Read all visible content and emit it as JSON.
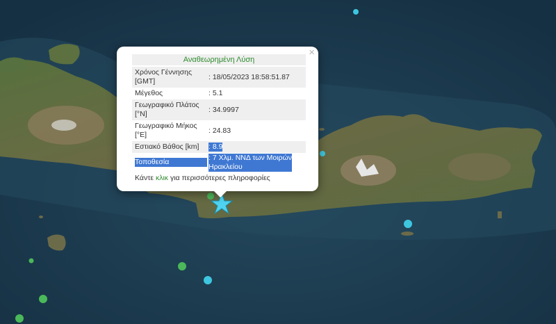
{
  "popup": {
    "title": "Αναθεωρημένη Λύση",
    "close_icon": "×",
    "rows": [
      {
        "label": "Χρόνος Γέννησης [GMT]",
        "value": ": 18/05/2023 18:58:51.87"
      },
      {
        "label": "Μέγεθος",
        "value": ": 5.1"
      },
      {
        "label": "Γεωγραφικό Πλάτος [°N]",
        "value": ": 34.9997"
      },
      {
        "label": "Γεωγραφικό Μήκος [°E]",
        "value": ": 24.83"
      },
      {
        "label": "Εστιακό Βάθος [km]",
        "value": ": 8.9"
      },
      {
        "label": "Τοποθεσία",
        "value": ": 7 Χλμ. ΝΝΔ των Μοιρών Ηρακλείου"
      }
    ],
    "more_prefix": "Κάντε ",
    "more_link": "κλικ",
    "more_suffix": " για περισσότερες πληροφορίες"
  },
  "map": {
    "colors": {
      "sea_deep": "#1b3a4f",
      "sea_shallow": "#2a5266",
      "land_green": "#4d6a3a",
      "land_brown": "#7a6a4f",
      "snow": "#e8e8e8",
      "marker_cyan": "#3ec6e0",
      "marker_green": "#4bb85a",
      "epicenter_star": "#4fd3f0"
    },
    "icons": [
      "epicenter-star-icon",
      "earthquake-marker-icon",
      "close-icon"
    ]
  }
}
